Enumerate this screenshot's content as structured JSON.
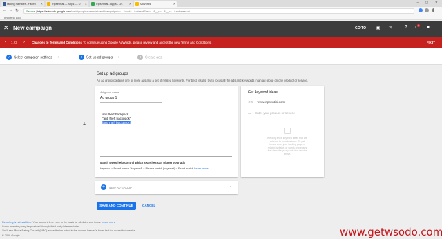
{
  "browser": {
    "tabs": [
      {
        "label": "talking hamster - Faceb",
        "color": "#3b5998",
        "active": false
      },
      {
        "label": "Tripsential — Apps — D",
        "color": "#f4b400",
        "active": false
      },
      {
        "label": "Tripsential - Apps - Gs",
        "color": "#34a853",
        "active": false
      },
      {
        "label": "AdWords",
        "color": "#fbbc04",
        "active": true
      }
    ],
    "secure": "Secure",
    "url_host": "https://adwords.google.com",
    "url_rest": "/aw/signup/express/wizard?campaignId=...&ocid=...&wizardStep=...&__u=...&__c=...&authuser=0",
    "bookmark": "Import to Lojo"
  },
  "header": {
    "title": "New campaign",
    "goto": "GO TO",
    "notification_count": "1"
  },
  "banner": {
    "counter": "1 / 3",
    "bold": "Changes to Terms and Conditions",
    "message": "To continue using Google AdWords, please review and accept the new Terms and Conditions.",
    "action": "FIX IT",
    "color": "#c5221f"
  },
  "steps": [
    {
      "label": "Select campaign settings",
      "state": "done",
      "marker": "✓"
    },
    {
      "label": "Set up ad groups",
      "state": "current",
      "marker": "2"
    },
    {
      "label": "Create ads",
      "state": "todo",
      "marker": "3"
    }
  ],
  "main": {
    "title": "Set up ad groups",
    "description": "An ad group contains one or more ads and a set of related keywords. For best results, try to focus all the ads and keywords in an ad group on one product or service.",
    "ad_group_label": "Ad group name",
    "ad_group_value": "Ad group 1",
    "keywords": [
      "anti theft backpack",
      "\"anti theft backpack\"",
      "[anti theft backpack]"
    ],
    "match_title": "Match types help control which searches can trigger your ads",
    "match_example": "keyword = Broad match  \"keyword\" = Phrase match  [keyword] = Exact match",
    "learn_more": "Learn more"
  },
  "ideas": {
    "title": "Get keyword ideas",
    "site": "www.tripsential.com",
    "product_placeholder": "Enter your product or service",
    "help_text": "We only show keyword ideas that are relevant to your business. To get ideas, enter your landing page, a related website, or words or phrases that describe your product or service above."
  },
  "new_group": {
    "label": "NEW AD GROUP"
  },
  "actions": {
    "save": "SAVE AND CONTINUE",
    "cancel": "CANCEL"
  },
  "footer": {
    "line1": "Reporting is not real-time.",
    "line1b": "Your account time zone is the basis for all dates and times.",
    "line1_link": "Learn more",
    "line2": "Some inventory may be provided through third party intermediaries.",
    "line3": "You'll see Media Rating Council (MRC) accreditation noted in the column header's hover text for accredited metrics.",
    "copyright": "© 2018 Google"
  },
  "watermark": "www.getwsodo.com"
}
